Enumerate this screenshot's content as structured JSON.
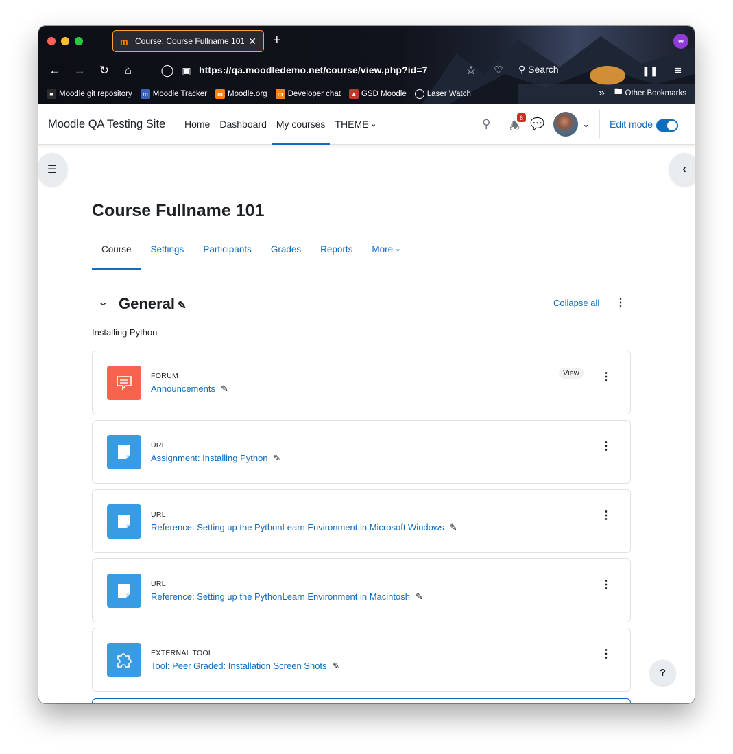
{
  "browser": {
    "tab_title": "Course: Course Fullname 101",
    "tab_logo": "m",
    "new_tab": "+",
    "close": "✕",
    "url": "https://qa.moodledemo.net/course/view.php?id=7",
    "search_label": "Search",
    "bookmarks": [
      {
        "label": "Moodle git repository",
        "color": "#2b2b2b"
      },
      {
        "label": "Moodle Tracker",
        "color": "#3c63b8"
      },
      {
        "label": "Moodle.org",
        "color": "#f98012"
      },
      {
        "label": "Developer chat",
        "color": "#f98012"
      },
      {
        "label": "GSD Moodle",
        "color": "#c0392b"
      },
      {
        "label": "Laser Watch",
        "color": "#555555"
      }
    ],
    "overflow_label": "»",
    "other_bookmarks": "Other Bookmarks"
  },
  "navbar": {
    "site_name": "Moodle QA Testing Site",
    "items": [
      "Home",
      "Dashboard",
      "My courses",
      "THEME"
    ],
    "active_index": 2,
    "notification_count": "6",
    "edit_mode_label": "Edit mode",
    "edit_mode_on": true
  },
  "course": {
    "title": "Course Fullname 101",
    "tabs": [
      "Course",
      "Settings",
      "Participants",
      "Grades",
      "Reports",
      "More"
    ],
    "active_tab": 0
  },
  "section": {
    "title": "General",
    "collapse_all_label": "Collapse all",
    "summary": "Installing Python"
  },
  "activities": [
    {
      "type": "FORUM",
      "name": "Announcements",
      "icon": "forum-icon",
      "color": "#f7634d",
      "view_label": "View"
    },
    {
      "type": "URL",
      "name": "Assignment: Installing Python",
      "icon": "url-icon",
      "color": "#399be2"
    },
    {
      "type": "URL",
      "name": "Reference: Setting up the PythonLearn Environment in Microsoft Windows",
      "icon": "url-icon",
      "color": "#399be2"
    },
    {
      "type": "URL",
      "name": "Reference: Setting up the PythonLearn Environment in Macintosh",
      "icon": "url-icon",
      "color": "#399be2"
    },
    {
      "type": "EXTERNAL TOOL",
      "name": "Tool: Peer Graded: Installation Screen Shots",
      "icon": "puzzle-icon",
      "color": "#399be2"
    }
  ],
  "help_label": "?",
  "colors": {
    "link": "#0f6cbf",
    "text": "#1d2125",
    "forum": "#f7634d",
    "resource": "#399be2",
    "badge": "#ca3120"
  }
}
